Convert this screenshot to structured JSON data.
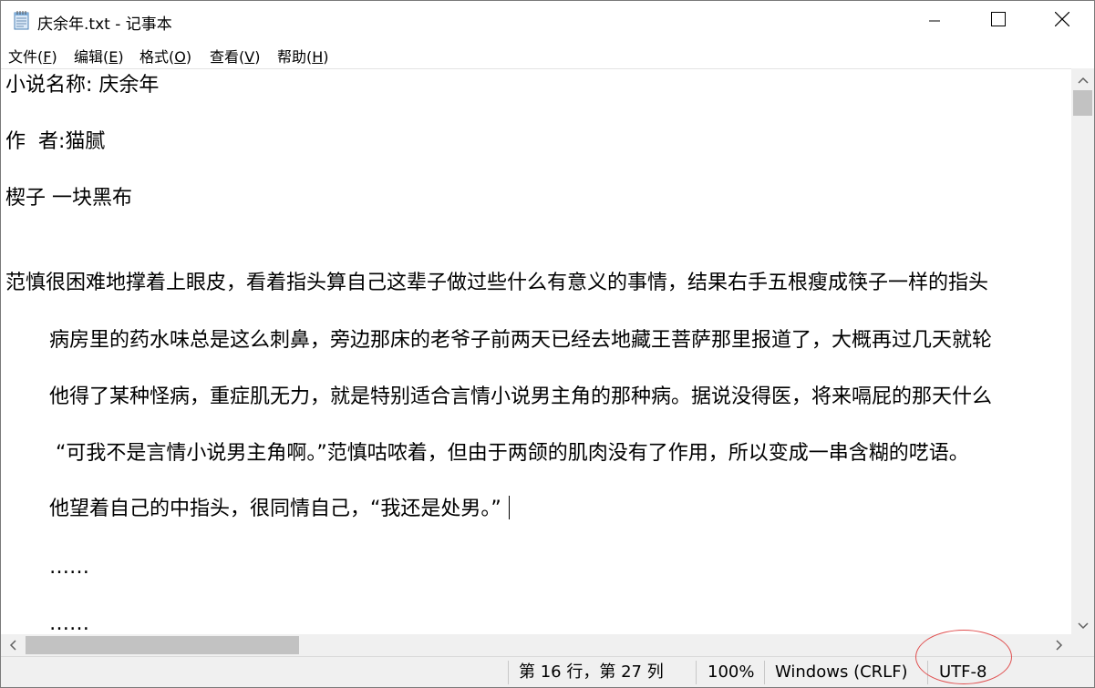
{
  "window": {
    "title": "庆余年.txt - 记事本",
    "icon": "notepad-icon",
    "controls": {
      "minimize_icon": "minimize-icon",
      "maximize_icon": "maximize-icon",
      "close_icon": "close-icon"
    }
  },
  "menu": {
    "items": [
      {
        "label": "文件(",
        "key": "F",
        "suffix": ")"
      },
      {
        "label": "编辑(",
        "key": "E",
        "suffix": ")"
      },
      {
        "label": "格式(",
        "key": "O",
        "suffix": ")"
      },
      {
        "label": "查看(",
        "key": "V",
        "suffix": ")"
      },
      {
        "label": "帮助(",
        "key": "H",
        "suffix": ")"
      }
    ]
  },
  "editor": {
    "lines": [
      "小说名称: 庆余年",
      "作  者:猫腻",
      "楔子 一块黑布",
      "范慎很困难地撑着上眼皮，看着指头算自己这辈子做过些什么有意义的事情，结果右手五根瘦成筷子一样的指头",
      "病房里的药水味总是这么刺鼻，旁边那床的老爷子前两天已经去地藏王菩萨那里报道了，大概再过几天就轮",
      "他得了某种怪病，重症肌无力，就是特别适合言情小说男主角的那种病。据说没得医，将来嗝屁的那天什么",
      "“可我不是言情小说男主角啊。”范慎咕哝着，但由于两颌的肌肉没有了作用，所以变成一串含糊的呓语。",
      "他望着自己的中指头，很同情自己，“我还是处男。”",
      "……",
      "……"
    ]
  },
  "statusbar": {
    "position": "第 16 行，第 27 列",
    "zoom": "100%",
    "line_ending": "Windows (CRLF)",
    "encoding": "UTF-8"
  },
  "colors": {
    "annotation": "#e05050",
    "scrollbar_track": "#f0f0f0",
    "scrollbar_thumb": "#c2c2c2"
  }
}
